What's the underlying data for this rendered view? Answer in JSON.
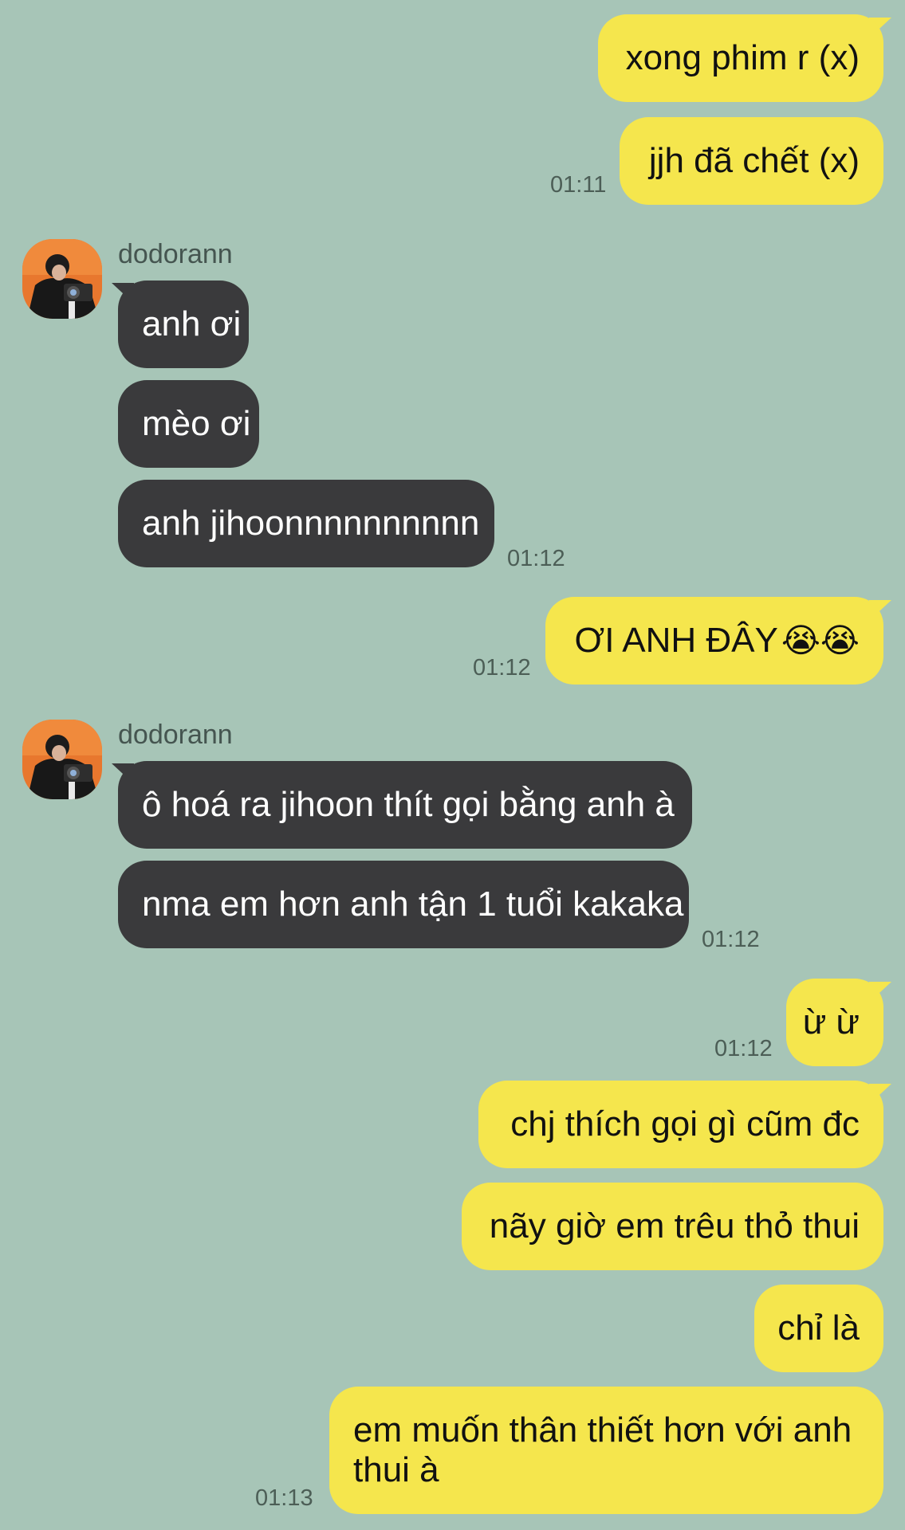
{
  "messages": [
    {
      "side": "me",
      "text": "xong phim r (x)"
    },
    {
      "side": "me",
      "text": "jjh đã chết (x)",
      "time": "01:11"
    },
    {
      "side": "other",
      "sender": "dodorann",
      "text": "anh ơi"
    },
    {
      "side": "other",
      "text": "mèo ơi"
    },
    {
      "side": "other",
      "text": "anh jihoonnnnnnnnnn",
      "time": "01:12"
    },
    {
      "side": "me",
      "text": "ƠI ANH ĐÂY",
      "emoji": "😭😭",
      "time": "01:12"
    },
    {
      "side": "other",
      "sender": "dodorann",
      "text": "ô hoá ra jihoon thít gọi bằng anh à"
    },
    {
      "side": "other",
      "text": "nma em hơn anh tận 1 tuổi kakaka",
      "time": "01:12"
    },
    {
      "side": "me",
      "text": "ừ ừ",
      "time": "01:12"
    },
    {
      "side": "me",
      "text": "chj thích gọi gì cũm đc"
    },
    {
      "side": "me",
      "text": "nãy giờ em trêu thỏ thui"
    },
    {
      "side": "me",
      "text": "chỉ là"
    },
    {
      "side": "me",
      "text": "em muốn thân thiết hơn với anh thui à",
      "time": "01:13"
    }
  ],
  "colors": {
    "background": "#a7c5b7",
    "my_bubble": "#f5e64d",
    "other_bubble": "#3a3a3c",
    "timestamp": "#4c5e56"
  }
}
